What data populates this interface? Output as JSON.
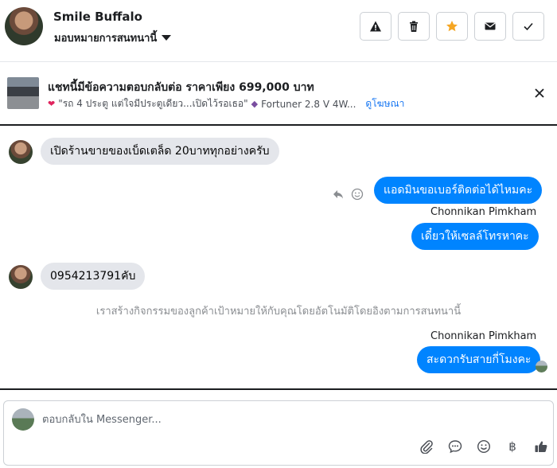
{
  "header": {
    "contact_name": "Smile Buffalo",
    "assign_label": "มอบหมายการสนทนานี้",
    "actions": [
      "warning-icon",
      "trash-icon",
      "star-icon",
      "envelope-icon",
      "check-icon"
    ],
    "star_color": "#f5a623"
  },
  "ad": {
    "title": "แชทนี้มีข้อความตอบกลับต่อ ราคาเพียง 699,000 บาท",
    "snippet_quote": "\"รถ 4 ประตู แต่ใจมีประตูเดียว...เปิดไว้รอเธอ\"",
    "snippet_car": "Fortuner 2.8 V 4W...",
    "link": "ดูโฆษณา"
  },
  "conversation": {
    "msg1": "เปิดร้านขายของเบ็ดเตล็ด 20บาททุกอย่างครับ",
    "msg2": "แอดมินขอเบอร์ติดต่อได้ไหมคะ",
    "sender1": "Chonnikan Pimkham",
    "msg3": "เดี๋ยวให้เซลล์โทรหาคะ",
    "msg4": "0954213791คับ",
    "system_note": "เราสร้างกิจกรรมของลูกค้าเป้าหมายให้กับคุณโดยอัตโนมัติโดยอิงตามการสนทนานี้",
    "sender2": "Chonnikan Pimkham",
    "msg5": "สะดวกรับสายกี่โมงคะ"
  },
  "composer": {
    "placeholder": "ตอบกลับใน Messenger...",
    "currency_symbol": "฿"
  },
  "colors": {
    "outgoing_bubble": "#0084ff",
    "incoming_bubble": "#e4e6eb",
    "link": "#1877f2"
  }
}
